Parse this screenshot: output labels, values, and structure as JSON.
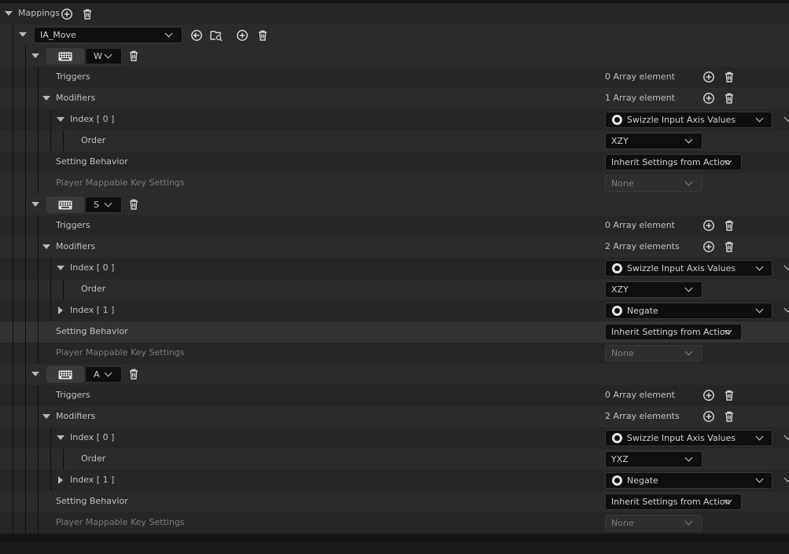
{
  "header": {
    "label": "Mappings",
    "add_icon": "add-circle-icon",
    "delete_icon": "trash-icon"
  },
  "action": {
    "value": "IA_Move",
    "icons": [
      "use-selected-arrow-icon",
      "browse-folder-icon",
      "add-circle-icon",
      "trash-icon"
    ]
  },
  "mappings": [
    {
      "key": "W",
      "triggers": {
        "label": "Triggers",
        "count": "0 Array element"
      },
      "modifiers": {
        "label": "Modifiers",
        "count": "1 Array element",
        "items": [
          {
            "index": "Index [ 0 ]",
            "expanded": true,
            "value": "Swizzle Input Axis Values",
            "order_label": "Order",
            "order": "XZY"
          }
        ]
      },
      "setting_behavior": {
        "label": "Setting Behavior",
        "value": "Inherit Settings from Action"
      },
      "player_mappable": {
        "label": "Player Mappable Key Settings",
        "value": "None"
      }
    },
    {
      "key": "S",
      "triggers": {
        "label": "Triggers",
        "count": "0 Array element"
      },
      "modifiers": {
        "label": "Modifiers",
        "count": "2 Array elements",
        "items": [
          {
            "index": "Index [ 0 ]",
            "expanded": true,
            "value": "Swizzle Input Axis Values",
            "order_label": "Order",
            "order": "XZY"
          },
          {
            "index": "Index [ 1 ]",
            "expanded": false,
            "value": "Negate"
          }
        ]
      },
      "setting_behavior": {
        "label": "Setting Behavior",
        "value": "Inherit Settings from Action"
      },
      "player_mappable": {
        "label": "Player Mappable Key Settings",
        "value": "None"
      }
    },
    {
      "key": "A",
      "triggers": {
        "label": "Triggers",
        "count": "0 Array element"
      },
      "modifiers": {
        "label": "Modifiers",
        "count": "2 Array elements",
        "items": [
          {
            "index": "Index [ 0 ]",
            "expanded": true,
            "value": "Swizzle Input Axis Values",
            "order_label": "Order",
            "order": "YXZ"
          },
          {
            "index": "Index [ 1 ]",
            "expanded": false,
            "value": "Negate"
          }
        ]
      },
      "setting_behavior": {
        "label": "Setting Behavior",
        "value": "Inherit Settings from Action"
      },
      "player_mappable": {
        "label": "Player Mappable Key Settings",
        "value": "None"
      }
    }
  ],
  "colors": {
    "panel": "#151515",
    "row": "#2b2b2b",
    "row_alt": "#262626",
    "combo": "#0f0f0f",
    "text": "#c0c0c0",
    "text_dim": "#7b7b7b"
  }
}
